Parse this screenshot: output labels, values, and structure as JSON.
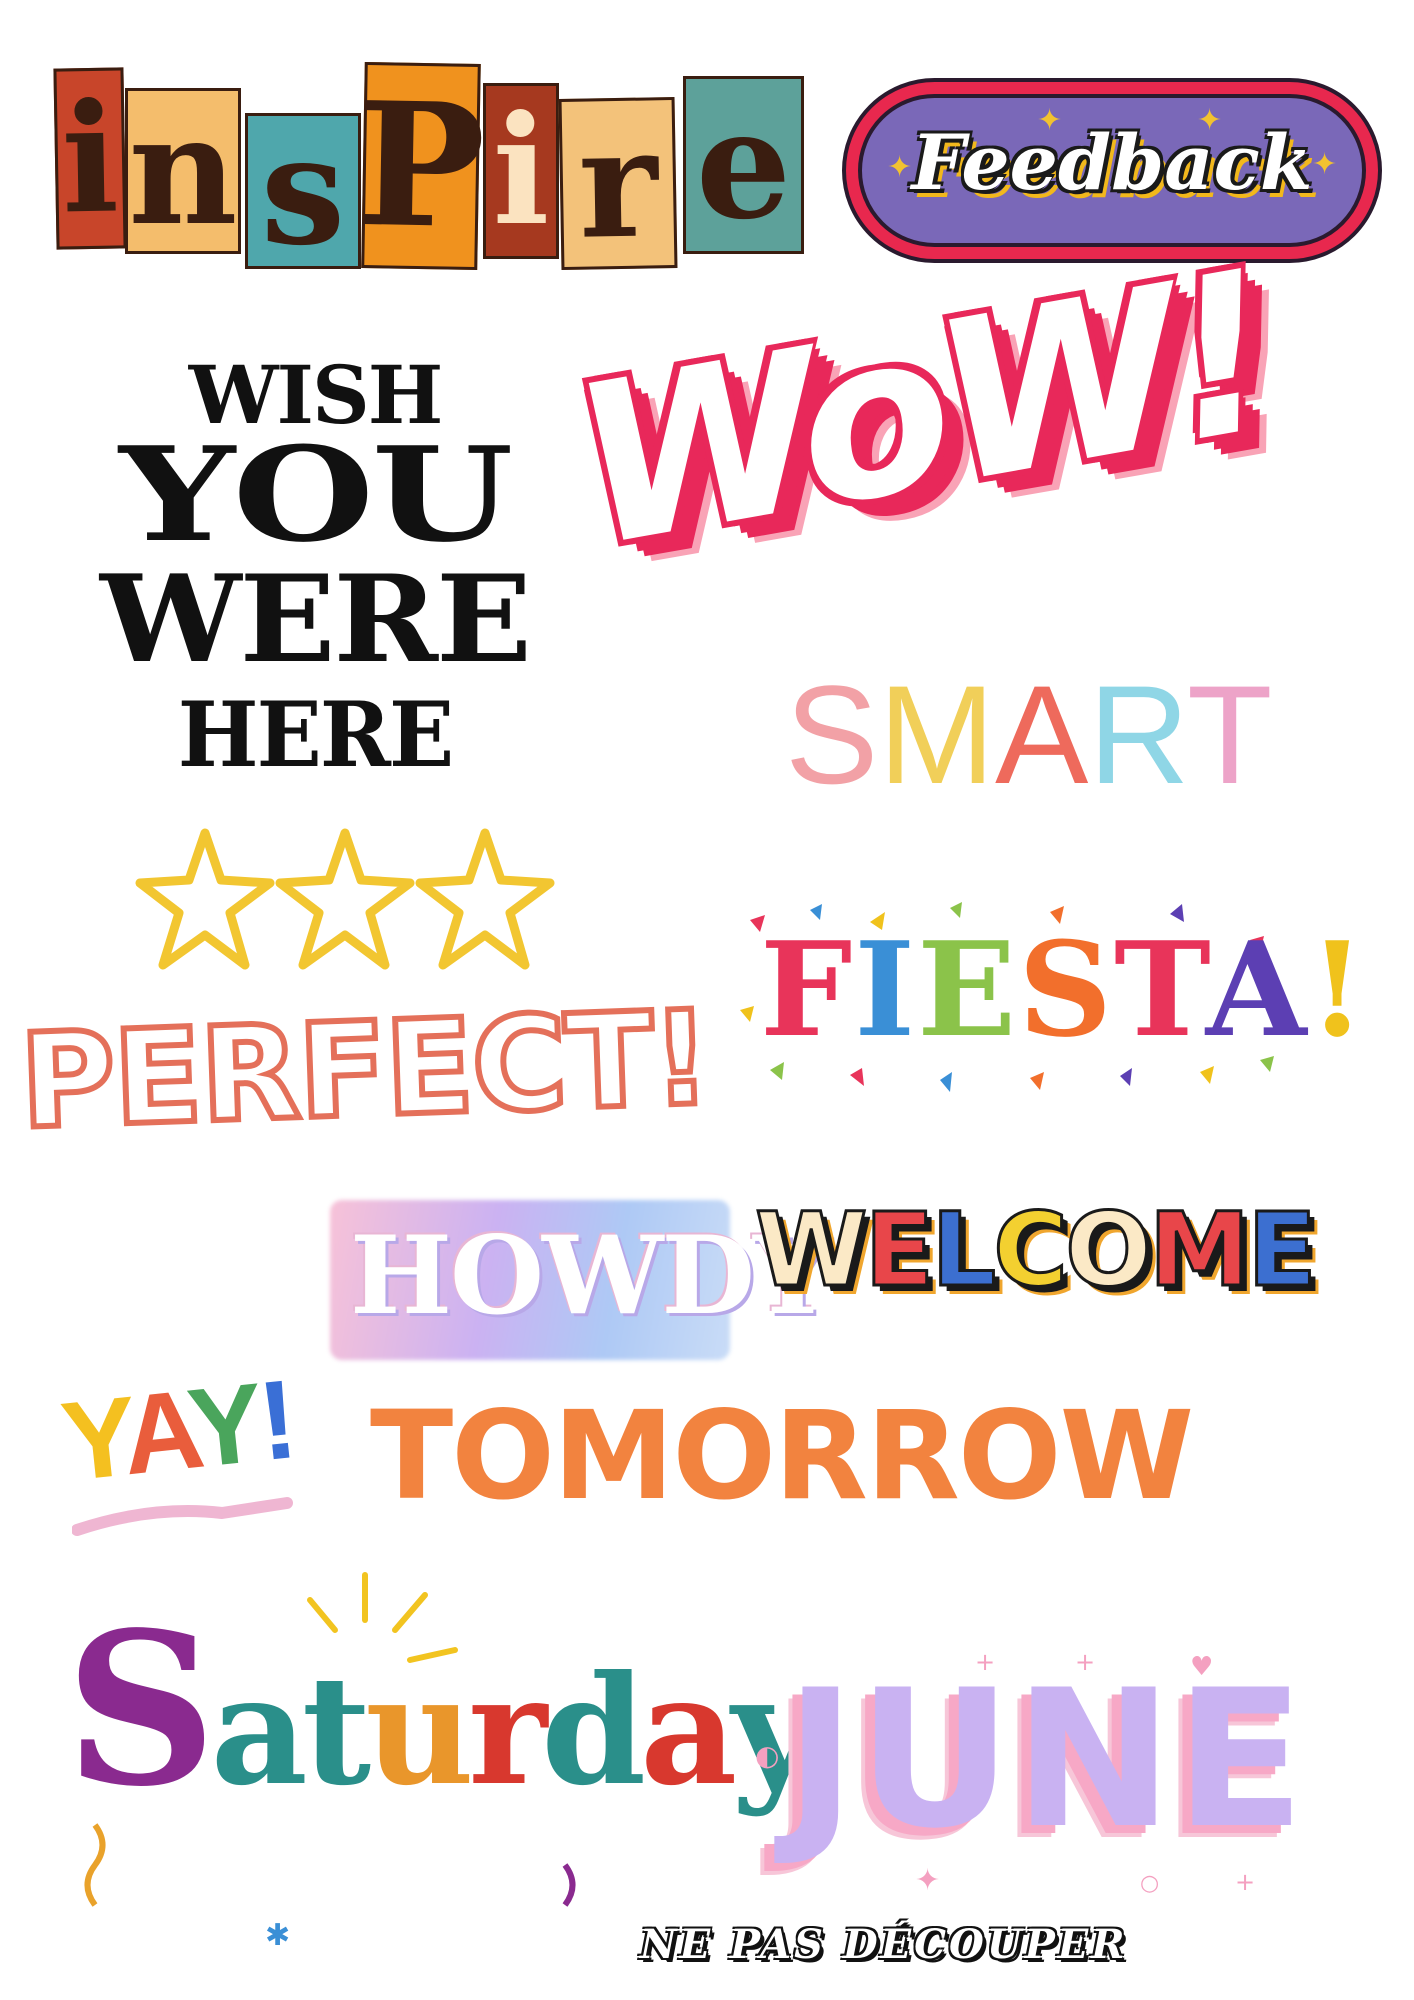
{
  "stickers": {
    "inspire": {
      "letters": [
        "i",
        "n",
        "s",
        "P",
        "i",
        "r",
        "e"
      ],
      "colors": [
        "#c8452a",
        "#f4bd6c",
        "#4fa7ac",
        "#f0921e",
        "#a6391f",
        "#f3c27a",
        "#5da19a"
      ]
    },
    "feedback": {
      "text": "Feedback"
    },
    "wish": {
      "line1": "WISH",
      "line2": "YOU",
      "line3": "WERE",
      "line4": "HERE"
    },
    "wow": {
      "text": "WoW!"
    },
    "smart": {
      "letters": [
        "S",
        "M",
        "A",
        "R",
        "T"
      ],
      "colors": [
        "#f2a1a6",
        "#f1cf59",
        "#ee6a5c",
        "#8fd6e6",
        "#eda3c8"
      ]
    },
    "perfect": {
      "text": "PERFECT!"
    },
    "fiesta": {
      "letters": [
        "F",
        "I",
        "E",
        "S",
        "T",
        "A",
        "!"
      ],
      "colors": [
        "#e8345a",
        "#3a8fd6",
        "#8bc34a",
        "#f26f2c",
        "#e8345a",
        "#5c3fb3",
        "#f0c21c"
      ]
    },
    "howdy": {
      "text": "HOWDY"
    },
    "welcome": {
      "letters": [
        "W",
        "E",
        "L",
        "C",
        "O",
        "M",
        "E"
      ],
      "colors": [
        "#fbe9c6",
        "#e8464a",
        "#3c6fd0",
        "#f3d030",
        "#fbe9c6",
        "#e8464a",
        "#3c6fd0"
      ]
    },
    "yay": {
      "letters": [
        "Y",
        "A",
        "Y",
        "!"
      ],
      "colors": [
        "#f4c020",
        "#e95d3c",
        "#4aa55c",
        "#3a6fd6"
      ]
    },
    "tomorrow": {
      "text": "TOMORROW"
    },
    "saturday": {
      "letters": [
        "S",
        "a",
        "t",
        "u",
        "r",
        "d",
        "a",
        "y"
      ],
      "colors": [
        "#8a2a8f",
        "#2a8f8a",
        "#2a8f8a",
        "#e9962b",
        "#d8382e",
        "#2a8f8a",
        "#d8382e",
        "#2a8f8a"
      ]
    },
    "june": {
      "text": "JUNE"
    },
    "footer": {
      "text": "NE PAS DÉCOUPER"
    }
  }
}
